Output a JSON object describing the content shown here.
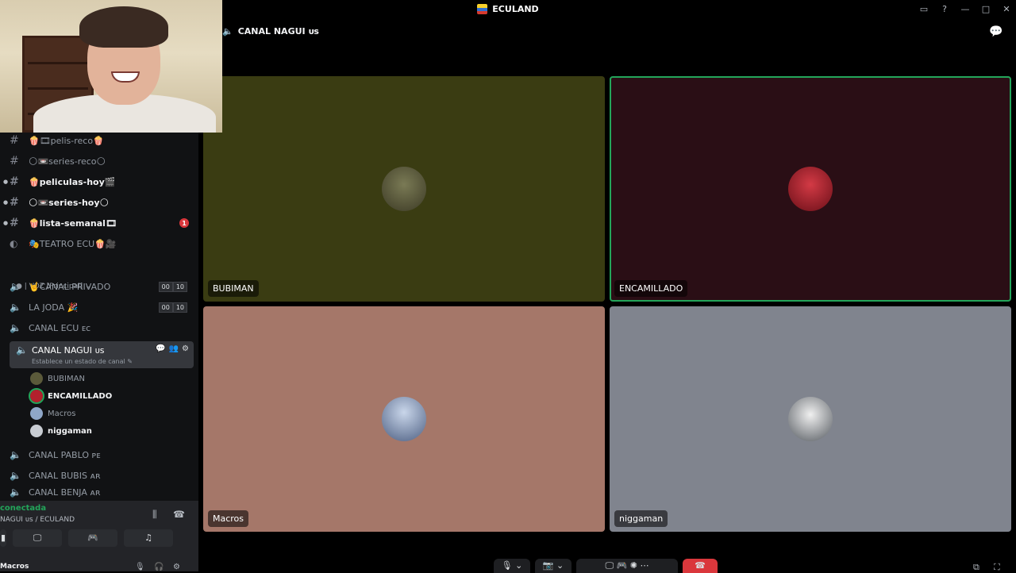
{
  "window": {
    "title": "ECULAND",
    "controls": [
      "▭",
      "?",
      "—",
      "□",
      "✕"
    ]
  },
  "sidebar": {
    "text_channels": [
      {
        "label": "🍿🎞pelis-reco🍿",
        "bold": false,
        "arrow": false
      },
      {
        "label": "🌕📼series-reco🌕",
        "bold": false,
        "arrow": false
      },
      {
        "label": "🍿peliculas-hoy🎬",
        "bold": true,
        "arrow": true
      },
      {
        "label": "🌕📼series-hoy🌕",
        "bold": true,
        "arrow": true
      },
      {
        "label": "🍿lista-semanal🎞",
        "bold": true,
        "arrow": true,
        "badge": "1"
      }
    ],
    "stage_channel": "🎭TEATRO ECU🍿🎥",
    "category": "| VOZ [Principal]",
    "voice_channels": [
      {
        "label": "🤘CANAL PRIVADO",
        "counts": [
          "00",
          "10"
        ]
      },
      {
        "label": "LA JODA 🎉",
        "counts": [
          "00",
          "10"
        ]
      },
      {
        "label": "CANAL ECU ᴇᴄ"
      }
    ],
    "active_channel": {
      "label": "CANAL NAGUI ᴜs",
      "status": "Establece un estado de canal ✎",
      "tools": [
        "💬",
        "👥",
        "⚙"
      ]
    },
    "members": [
      {
        "name": "BUBIMAN",
        "bold": false
      },
      {
        "name": "ENCAMILLADO",
        "bold": true
      },
      {
        "name": "Macros",
        "bold": false
      },
      {
        "name": "niggaman",
        "bold": true
      }
    ],
    "more_channels": [
      "CANAL PABLO ᴘᴇ",
      "CANAL BUBIS ᴀʀ",
      "CANAL BENJA ᴀʀ"
    ],
    "voice_status": {
      "state": "conectada",
      "location": "NAGUI ᴜs / ECULAND"
    },
    "user": {
      "name": "Macros"
    }
  },
  "main": {
    "channel_title": "CANAL NAGUI ᴜs",
    "tiles": [
      {
        "name": "BUBIMAN",
        "bg": "#3a3c12",
        "avatar": "#5b5a3a"
      },
      {
        "name": "ENCAMILLADO",
        "bg": "#2a0e15",
        "avatar": "#b3212d",
        "speaking": true
      },
      {
        "name": "Macros",
        "bg": "#a57769",
        "avatar": "#8fa7c8"
      },
      {
        "name": "niggaman",
        "bg": "#80848e",
        "avatar": "#c8ccd2"
      }
    ]
  },
  "colors": {
    "accent_green": "#23a55a",
    "danger_red": "#da373c"
  }
}
